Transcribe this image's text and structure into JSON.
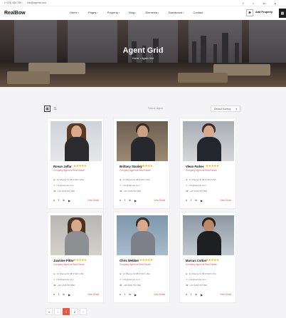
{
  "topbar": {
    "phone": "(+123) 456 789",
    "email": "info@agents.com",
    "socials": [
      "f",
      "t",
      "in",
      "p"
    ]
  },
  "nav": {
    "logo": "RealBow",
    "menu": [
      "Home",
      "Pages",
      "Property",
      "Blog",
      "Elements",
      "Dashboard",
      "Contact"
    ],
    "add_property": "Add Property",
    "user_icon": "user-icon",
    "grid_icon": "grid-icon"
  },
  "hero": {
    "title": "Agent Grid",
    "crumb_home": "Home",
    "crumb_sep": ">",
    "crumb_current": "Agent Grid"
  },
  "controls": {
    "search_placeholder": "Search Agent",
    "sort_label": "Default Sorting"
  },
  "agents": [
    {
      "name": "Ronan Jaffar",
      "role": "Company Agent at Real Estate",
      "address": "21 Sherpa St 98 NYRO USA",
      "email": "info@sample.com",
      "phone": "+00 1234 567 890",
      "view": "View Detail"
    },
    {
      "name": "Brittany Stanley",
      "role": "Company Agent at Real Estate",
      "address": "21 Sherpa St 98 NYRO USA",
      "email": "info@sample.com",
      "phone": "+00 1234 567 890",
      "view": "View Detail"
    },
    {
      "name": "Vlean Parker",
      "role": "Company Agent at Real Estate",
      "address": "21 Sherpa St 98 NYRO USA",
      "email": "info@sample.com",
      "phone": "+00 1234 567 890",
      "view": "View Detail"
    },
    {
      "name": "Jasmine Pittor",
      "role": "Company Agent at Real Estate",
      "address": "21 Sherpa St 98 NYRO USA",
      "email": "info@sample.com",
      "phone": "+00 1234 567 890",
      "view": "View Detail"
    },
    {
      "name": "Chris Webber",
      "role": "Company Agent at Real Estate",
      "address": "21 Sherpa St 98 NYRO USA",
      "email": "info@sample.com",
      "phone": "+00 1234 567 890",
      "view": "View Detail"
    },
    {
      "name": "Marcus Colton",
      "role": "Company Agent at Real Estate",
      "address": "21 Sherpa St 98 NYRO USA",
      "email": "info@sample.com",
      "phone": "+00 1234 567 890",
      "view": "View Detail"
    }
  ],
  "rating": "★★★★★",
  "pagination": [
    "«",
    "‹",
    "1",
    "2",
    "›"
  ],
  "colors": {
    "accent": "#e2584a",
    "star": "#f5a623"
  }
}
